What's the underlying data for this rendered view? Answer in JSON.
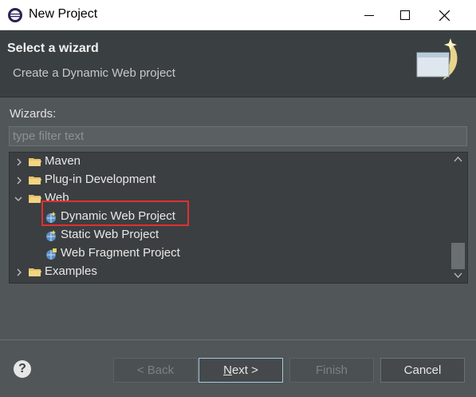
{
  "window": {
    "title": "New Project",
    "icon": "eclipse-icon"
  },
  "header": {
    "title": "Select a wizard",
    "description": "Create a Dynamic Web project",
    "banner_icon": "wizard-banner-icon"
  },
  "wizards": {
    "label": "Wizards:",
    "filter_placeholder": "type filter text",
    "filter_value": ""
  },
  "tree": {
    "items": [
      {
        "label": "Maven",
        "level": 0,
        "expanded": false,
        "type": "folder"
      },
      {
        "label": "Plug-in Development",
        "level": 0,
        "expanded": false,
        "type": "folder"
      },
      {
        "label": "Web",
        "level": 0,
        "expanded": true,
        "type": "folder"
      },
      {
        "label": "Dynamic Web Project",
        "level": 1,
        "type": "project",
        "selected": true
      },
      {
        "label": "Static Web Project",
        "level": 1,
        "type": "project"
      },
      {
        "label": "Web Fragment Project",
        "level": 1,
        "type": "project"
      },
      {
        "label": "Examples",
        "level": 0,
        "expanded": false,
        "type": "folder"
      }
    ]
  },
  "buttons": {
    "help": "?",
    "back": "< Back",
    "next_mnemonic": "N",
    "next_rest": "ext >",
    "finish": "Finish",
    "cancel": "Cancel"
  },
  "colors": {
    "background": "#515658",
    "header_bg": "#3a3f41",
    "tree_bg": "#3b3f41",
    "highlight_box": "#e03030"
  }
}
